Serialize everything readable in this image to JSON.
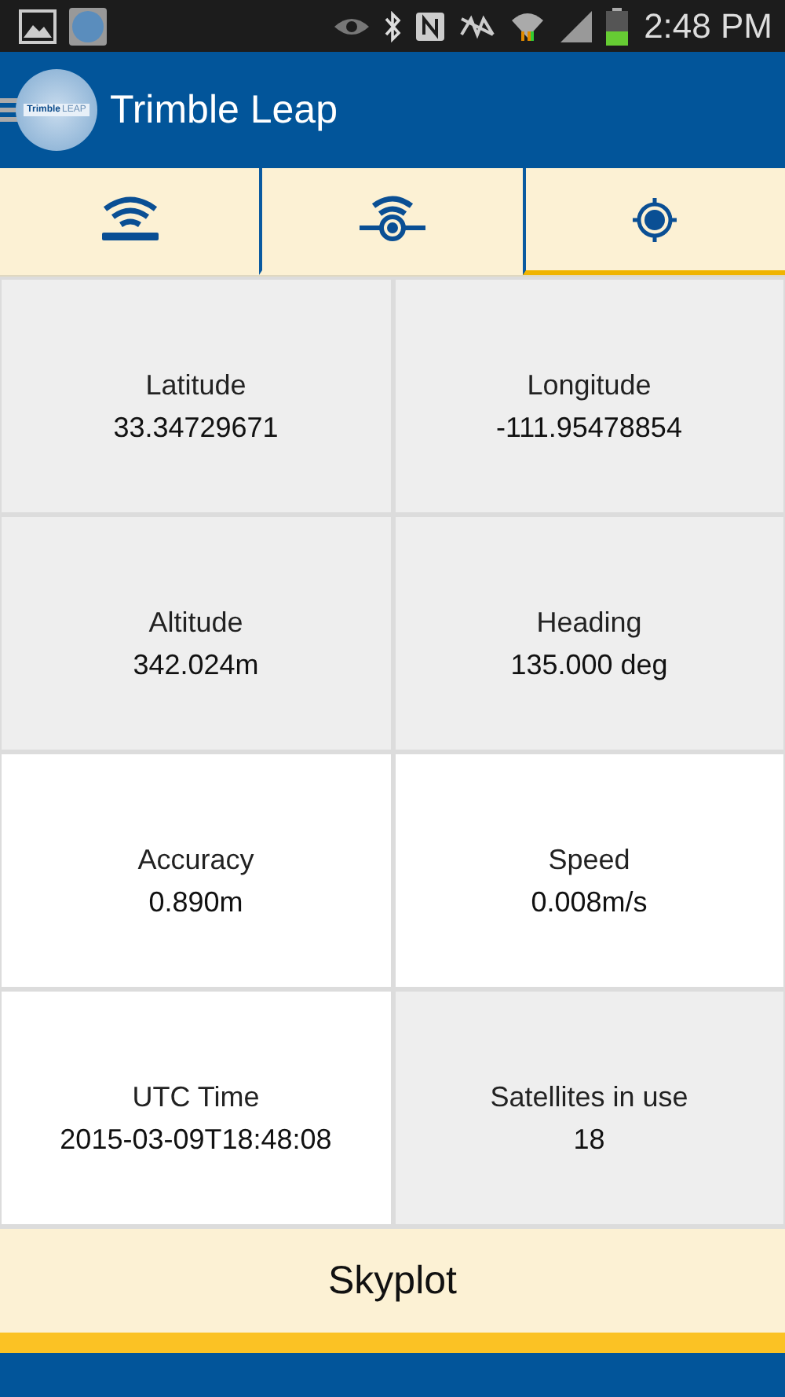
{
  "status_bar": {
    "time": "2:48 PM"
  },
  "app_bar": {
    "title": "Trimble Leap",
    "logo_text": [
      "Trimble",
      "LEAP"
    ]
  },
  "tabs": [
    {
      "kind": "receiver",
      "selected": false
    },
    {
      "kind": "broadcast",
      "selected": false
    },
    {
      "kind": "position",
      "selected": true
    }
  ],
  "cells": [
    {
      "label": "Latitude",
      "value": "33.34729671",
      "shaded": true
    },
    {
      "label": "Longitude",
      "value": "-111.95478854",
      "shaded": true
    },
    {
      "label": "Altitude",
      "value": "342.024m",
      "shaded": true
    },
    {
      "label": "Heading",
      "value": "135.000 deg",
      "shaded": true
    },
    {
      "label": "Accuracy",
      "value": "0.890m",
      "shaded": false
    },
    {
      "label": "Speed",
      "value": "0.008m/s",
      "shaded": false
    },
    {
      "label": "UTC Time",
      "value": "2015-03-09T18:48:08",
      "shaded": false
    },
    {
      "label": "Satellites in use",
      "value": "18",
      "shaded": true
    }
  ],
  "skyplot_button": "Skyplot"
}
